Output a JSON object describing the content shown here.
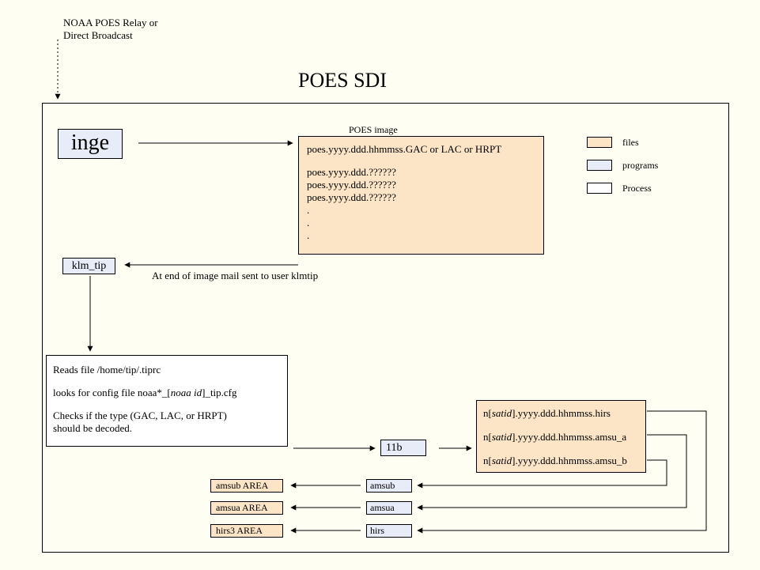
{
  "input_label": "NOAA POES Relay or\nDirect Broadcast",
  "title": "POES SDI",
  "inge": "inge",
  "klm_tip": "klm_tip",
  "mail_note": "At end of image mail sent to user klmtip",
  "poes_image_label": "POES image",
  "poes_image_lines": {
    "l1": "poes.yyyy.ddd.hhmmss.GAC or LAC or HRPT",
    "l2": "poes.yyyy.ddd.??????",
    "l3": "poes.yyyy.ddd.??????",
    "l4": "poes.yyyy.ddd.??????",
    "l5": ".",
    "l6": ".",
    "l7": "."
  },
  "tip_process": {
    "l1": "Reads file /home/tip/.tiprc",
    "l2_pre": "looks for config file noaa*_[",
    "l2_it": "noaa id",
    "l2_post": "]_tip.cfg",
    "l3": "Checks if the type (GAC, LAC, or HRPT)",
    "l4": "should be decoded."
  },
  "box_11b": "11b",
  "output_files": {
    "hirs_pre": "n[",
    "hirs_it": "satid",
    "hirs_post": "].yyyy.ddd.hhmmss.hirs",
    "amsua_pre": "n[",
    "amsua_it": "satid",
    "amsua_post": "].yyyy.ddd.hhmmss.amsu_a",
    "amsub_pre": "n[",
    "amsub_it": "satid",
    "amsub_post": "].yyyy.ddd.hhmmss.amsu_b"
  },
  "prog_amsub": "amsub",
  "prog_amsua": "amsua",
  "prog_hirs": "hirs",
  "area_amsub": "amsub AREA",
  "area_amsua": "amsua AREA",
  "area_hirs3": "hirs3 AREA",
  "legend": {
    "files": "files",
    "programs": "programs",
    "process": "Process"
  }
}
